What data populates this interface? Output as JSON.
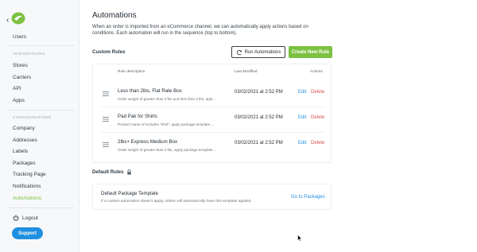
{
  "sidebar": {
    "back_glyph": "‹",
    "users": "Users",
    "integrations_label": "INTEGRATIONS",
    "integrations": [
      "Stores",
      "Carriers",
      "API",
      "Apps"
    ],
    "configurations_label": "CONFIGURATIONS",
    "configurations": [
      "Company",
      "Addresses",
      "Labels",
      "Packages",
      "Tracking Page",
      "Notifications",
      "Automations"
    ],
    "logout": "Logout",
    "support": "Support"
  },
  "main": {
    "title": "Automations",
    "description": "When an order is imported from an eCommerce channel, we can automatically apply actions based on conditions. Each automation will run in the sequence (top to bottom).",
    "custom_rules_label": "Custom Rules",
    "run_automations": "Run Automations",
    "create_new_rule": "Create New Rule",
    "table": {
      "headers": {
        "description": "Rule description",
        "modified": "Last Modified",
        "actions": "Actions"
      },
      "rows": [
        {
          "name": "Less than 2lbs, Flat Rate Box",
          "desc": "Order weight of greater than 0 lbs and less than 2 lbs, appl...",
          "modified": "03/02/2021 at 2:52 PM",
          "edit": "Edit",
          "delete": "Delete"
        },
        {
          "name": "Pad Pak for Shirts",
          "desc": "Product name of includes \"shirt\", apply package template ...",
          "modified": "03/02/2021 at 2:52 PM",
          "edit": "Edit",
          "delete": "Delete"
        },
        {
          "name": "2lbs+ Express Medium Box",
          "desc": "Order weight of greater than 2 lbs, apply package template ...",
          "modified": "03/02/2021 at 2:52 PM",
          "edit": "Edit",
          "delete": "Delete"
        }
      ]
    },
    "default_rules_label": "Default Rules",
    "default_package": {
      "title": "Default Package Template",
      "desc": "If a custom automation doesn't apply, orders will automatically have this template applied.",
      "link": "Go to Packages"
    }
  },
  "colors": {
    "accent_green": "#7cc142",
    "link_blue": "#1f8fe0",
    "delete_red": "#d9534f"
  }
}
